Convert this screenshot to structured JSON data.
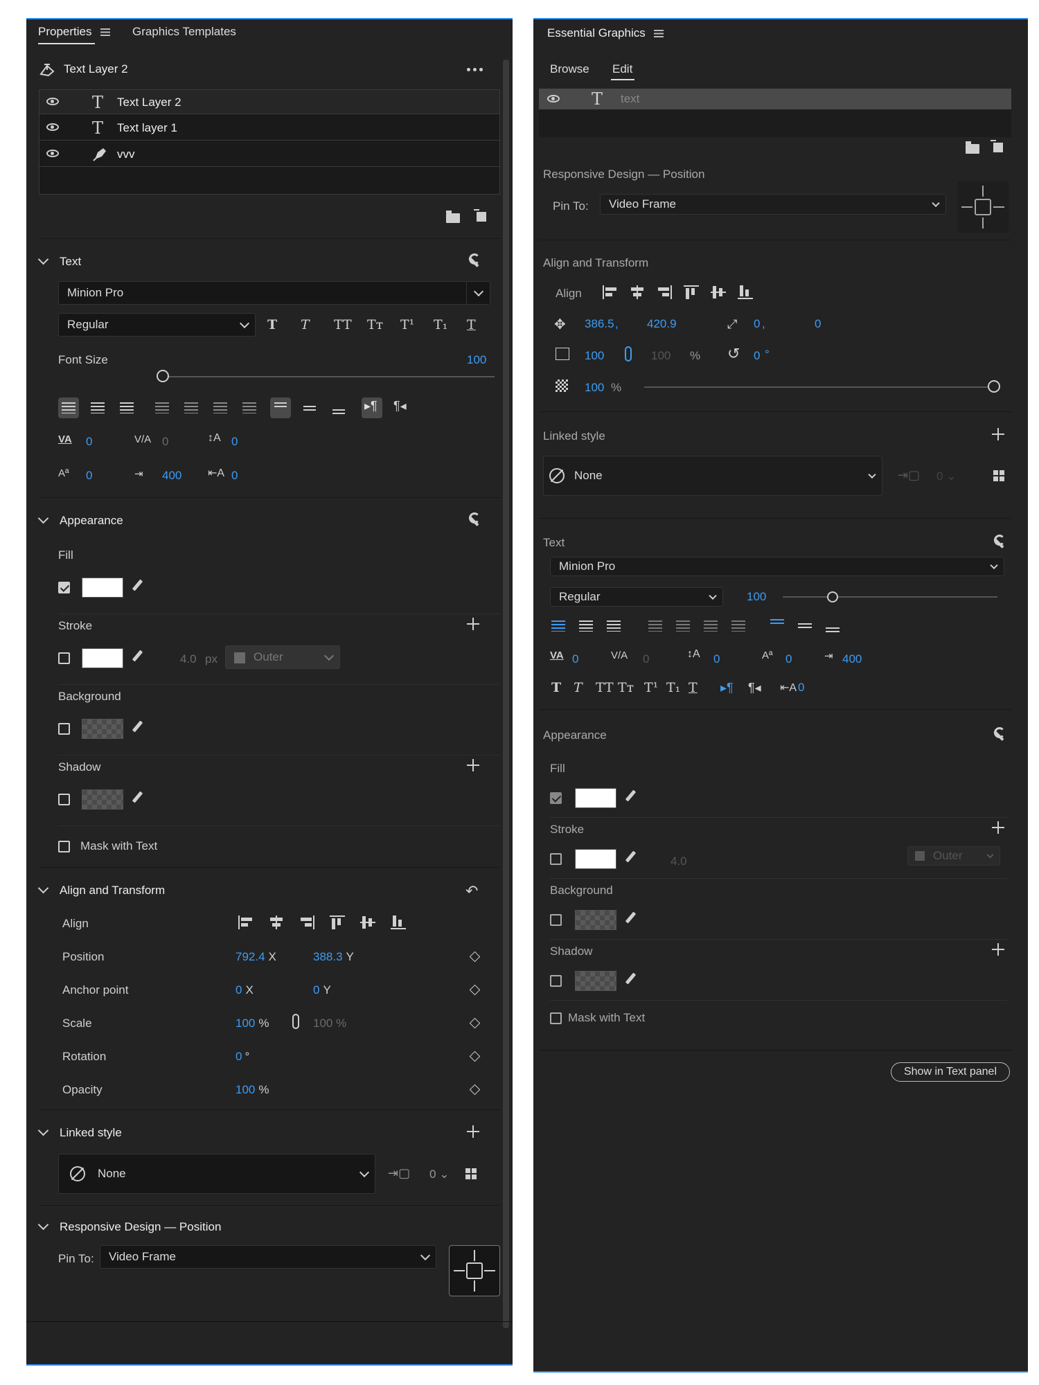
{
  "left": {
    "tabs": [
      "Properties",
      "Graphics Templates"
    ],
    "layer_title": "Text Layer 2",
    "layers": [
      {
        "name": "Text Layer 2",
        "icon": "text-icon"
      },
      {
        "name": "Text layer 1",
        "icon": "text-icon"
      },
      {
        "name": "vvv",
        "icon": "pen-icon"
      }
    ],
    "text_section": {
      "title": "Text",
      "font": "Minion Pro",
      "style": "Regular",
      "style_glyphs": [
        "T",
        "T",
        "TT",
        "Tт",
        "T¹",
        "T₁",
        "T"
      ],
      "font_size_label": "Font Size",
      "font_size": "100",
      "kerning": "0",
      "tracking": "0",
      "leading": "0",
      "baseline": "0",
      "tab_width": "400",
      "tsume": "0"
    },
    "appearance": {
      "title": "Appearance",
      "fill": "Fill",
      "stroke": "Stroke",
      "stroke_width": "4.0",
      "stroke_unit": "px",
      "stroke_type": "Outer",
      "background": "Background",
      "shadow": "Shadow",
      "mask": "Mask with Text"
    },
    "transform": {
      "title": "Align and Transform",
      "align": "Align",
      "position": "Position",
      "pos_x": "792.4",
      "pos_y": "388.3",
      "anchor": "Anchor point",
      "anchor_x": "0",
      "anchor_y": "0",
      "scale": "Scale",
      "scale_val": "100",
      "scale_val2": "100 %",
      "rotation": "Rotation",
      "rotation_val": "0",
      "opacity": "Opacity",
      "opacity_val": "100",
      "x": "X",
      "y": "Y",
      "pct": "%",
      "deg": "°"
    },
    "linked": {
      "title": "Linked style",
      "value": "None",
      "count": "0"
    },
    "responsive": {
      "title": "Responsive Design — Position",
      "pin_label": "Pin To:",
      "pin_value": "Video Frame"
    }
  },
  "right": {
    "title": "Essential Graphics",
    "tabs": [
      "Browse",
      "Edit"
    ],
    "layer": "text",
    "responsive": {
      "title": "Responsive Design — Position",
      "pin_label": "Pin To:",
      "pin_value": "Video Frame"
    },
    "transform": {
      "title": "Align and Transform",
      "align": "Align",
      "pos_x": "386.5",
      "comma": ",",
      "pos_y": "420.9",
      "anchor_x": "0",
      "anchor_y": "0",
      "scale": "100",
      "scale2": "100",
      "pct": "%",
      "rotation": "0",
      "deg": "°",
      "opacity": "100"
    },
    "linked": {
      "title": "Linked style",
      "value": "None",
      "count": "0"
    },
    "text_section": {
      "title": "Text",
      "font": "Minion Pro",
      "style": "Regular",
      "font_size": "100",
      "kerning": "0",
      "tracking": "0",
      "leading": "0",
      "baseline": "0",
      "tab_width": "400",
      "tsume": "0",
      "style_glyphs": [
        "T",
        "T",
        "TT",
        "Tт",
        "T¹",
        "T₁",
        "T"
      ]
    },
    "appearance": {
      "title": "Appearance",
      "fill": "Fill",
      "stroke": "Stroke",
      "stroke_width": "4.0",
      "stroke_type": "Outer",
      "background": "Background",
      "shadow": "Shadow",
      "mask": "Mask with Text"
    },
    "show_button": "Show in Text panel"
  },
  "colors": {
    "accent": "#2d8ceb",
    "value_blue": "#3d9cf5",
    "panel": "#232323"
  }
}
